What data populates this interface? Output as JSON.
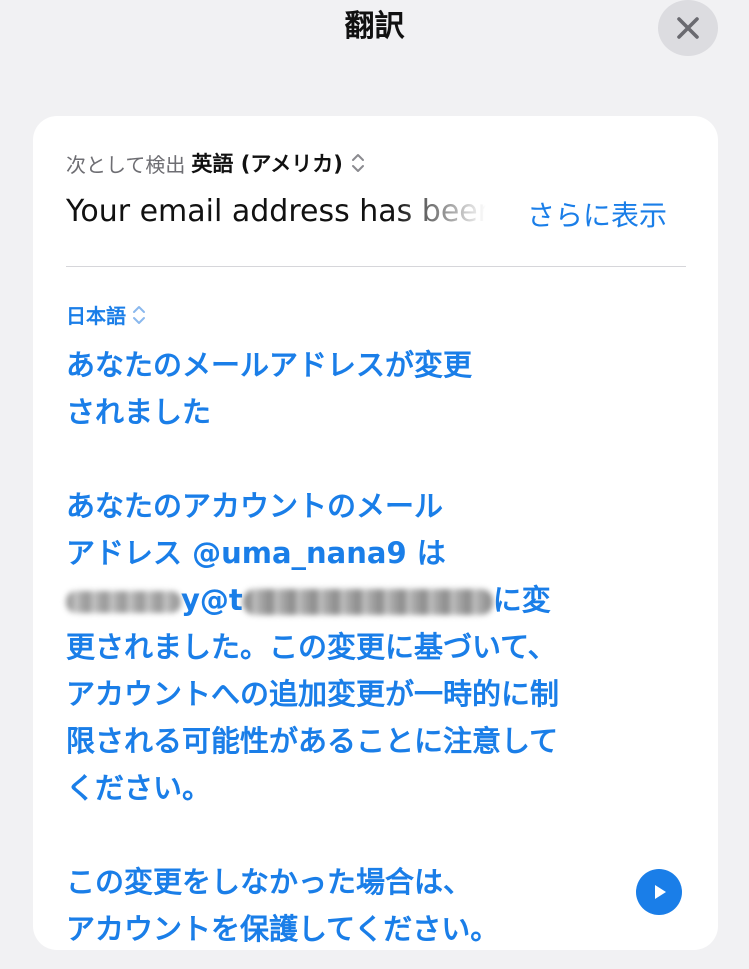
{
  "header": {
    "title": "翻訳",
    "close_icon": "close-icon"
  },
  "source": {
    "detected_prefix": "次として検出",
    "detected_language": "英語 (アメリカ)",
    "language_picker_icon": "chevron-up-down-icon",
    "text": "Your email address has been changed",
    "show_more_label": "さらに表示"
  },
  "target": {
    "language": "日本語",
    "language_picker_icon": "chevron-up-down-icon",
    "lines": {
      "l1": "あなたのメールアドレスが変更",
      "l2": "されました",
      "l3": "あなたのアカウントのメール",
      "l4": "アドレス @uma_nana9 は",
      "l5_a": "y@t",
      "l5_b": "に変",
      "l6": "更されました。この変更に基づいて、",
      "l7": "アカウントへの追加変更が一時的に制",
      "l8": "限される可能性があることに注意して",
      "l9": "ください。",
      "l10": "この変更をしなかった場合は、",
      "l11": "アカウントを保護してください。"
    },
    "play_icon": "play-icon"
  },
  "colors": {
    "accent": "#1a7ee8",
    "background": "#f1f1f3",
    "card": "#ffffff",
    "secondary_text": "#6e6e73"
  }
}
